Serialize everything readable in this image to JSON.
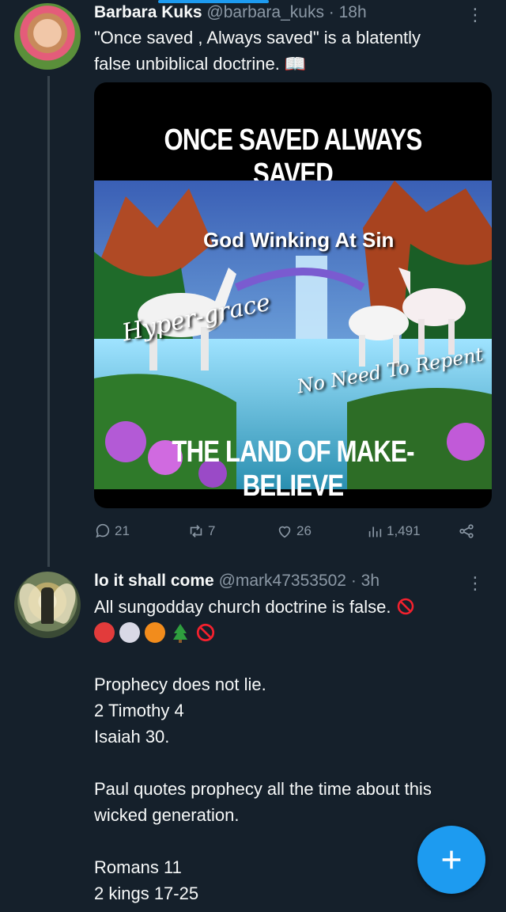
{
  "post1": {
    "name": "Barbara Kuks",
    "handle_time": "@barbara_kuks · 18h",
    "text_line1": "\"Once saved , Always saved\" is a blatently",
    "text_line2": "false unbiblical doctrine. 📖",
    "media": {
      "caption_top": "ONCE SAVED ALWAYS SAVED",
      "caption_bottom": "THE LAND OF MAKE-BELIEVE",
      "overlay_god": "God Winking At Sin",
      "overlay_hyper": "Hyper-grace",
      "overlay_repent": "No Need To Repent"
    },
    "actions": {
      "replies": "21",
      "reposts": "7",
      "likes": "26",
      "views": "1,491"
    }
  },
  "post2": {
    "name": "lo it shall come",
    "handle_time": "@mark47353502 · 3h",
    "text_line1": "All sungodday church doctrine is false.",
    "lines": [
      "Prophecy does not lie.",
      "2 Timothy 4",
      "Isaiah 30.",
      "",
      "Paul quotes prophecy all the time about this",
      "wicked generation.",
      "",
      "Romans 11",
      "2 kings 17-25"
    ]
  },
  "colors": {
    "background": "#15202b",
    "accent": "#1d9bf0",
    "muted": "#8b98a5",
    "prohibited": "#f4212e"
  },
  "icons": [
    "reply-icon",
    "repost-icon",
    "like-icon",
    "views-icon",
    "share-icon",
    "more-icon",
    "compose-icon"
  ]
}
